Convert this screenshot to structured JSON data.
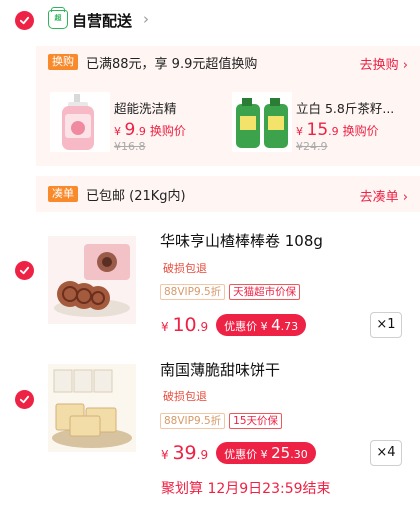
{
  "store": {
    "name": "自营配送",
    "icon": "tmall-supermarket-store-icon"
  },
  "exchange_promo": {
    "tag": "换购",
    "text": "已满88元，享 9.9元超值换购",
    "link": "去换购"
  },
  "gifts": [
    {
      "name": "超能洗洁精",
      "currency": "¥",
      "price_int": "9",
      "price_dec": ".9",
      "action": "换购价",
      "old_price": "¥16.8"
    },
    {
      "name": "立白 5.8斤茶籽...",
      "currency": "¥",
      "price_int": "15",
      "price_dec": ".9",
      "action": "换购价",
      "old_price": "¥24.9"
    }
  ],
  "shipping_promo": {
    "tag": "凑单",
    "text": "已包邮 (21Kg内)",
    "link": "去凑单"
  },
  "items": [
    {
      "title": "华味亨山楂棒棒卷 108g",
      "note": "破损包退",
      "badges": [
        "88VIP9.5折",
        "天猫超市价保"
      ],
      "currency": "¥",
      "price_int": "10",
      "price_dec": ".9",
      "discount_label": "优惠价",
      "discount_currency": "¥",
      "discount_int": "4",
      "discount_dec": ".73",
      "qty": "×1"
    },
    {
      "title": "南国薄脆甜味饼干",
      "note": "破损包退",
      "badges": [
        "88VIP9.5折",
        "15天价保"
      ],
      "currency": "¥",
      "price_int": "39",
      "price_dec": ".9",
      "discount_label": "优惠价",
      "discount_currency": "¥",
      "discount_int": "25",
      "discount_dec": ".30",
      "qty": "×4"
    }
  ],
  "deadline": "聚划算 12月9日23:59结束",
  "colors": {
    "accent": "#ee2244",
    "tag_orange": "#f98a2c",
    "promo_bg": "#fff5f3"
  }
}
